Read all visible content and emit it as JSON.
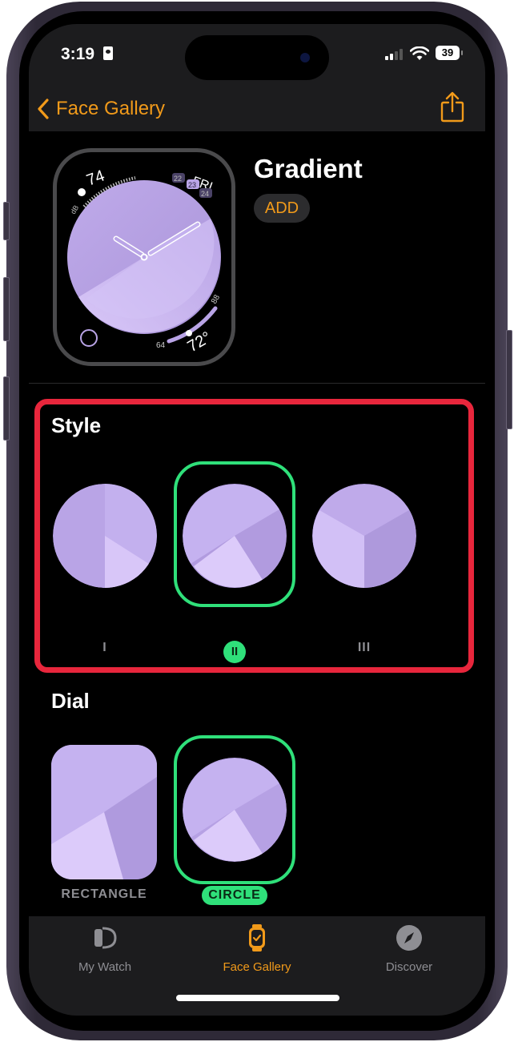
{
  "status_bar": {
    "time": "3:19",
    "battery": "39"
  },
  "nav": {
    "back_label": "Face Gallery",
    "back_icon": "chevron-left-icon",
    "share_icon": "share-icon"
  },
  "face": {
    "title": "Gradient",
    "add_label": "ADD",
    "complications": {
      "decibels_value": "74",
      "decibels_unit": "dB",
      "weekday": "FRI",
      "dates": [
        "22",
        "23",
        "24"
      ],
      "temp_low": "64",
      "temp_high": "88",
      "temp_current": "72°"
    }
  },
  "style_section": {
    "title": "Style",
    "options": [
      {
        "label": "I",
        "selected": false
      },
      {
        "label": "II",
        "selected": true
      },
      {
        "label": "III",
        "selected": false
      }
    ]
  },
  "dial_section": {
    "title": "Dial",
    "options": [
      {
        "label": "RECTANGLE",
        "selected": false
      },
      {
        "label": "CIRCLE",
        "selected": true
      }
    ]
  },
  "tabbar": {
    "tabs": [
      {
        "label": "My Watch",
        "icon": "watch-outline-icon",
        "active": false
      },
      {
        "label": "Face Gallery",
        "icon": "watch-face-icon",
        "active": true
      },
      {
        "label": "Discover",
        "icon": "compass-icon",
        "active": false
      }
    ]
  },
  "colors": {
    "accent": "#f19a1a",
    "selection": "#2fe07a",
    "highlight_box": "#e8263c",
    "gradient_light": "#dccbfa",
    "gradient_dark": "#a994d8"
  }
}
